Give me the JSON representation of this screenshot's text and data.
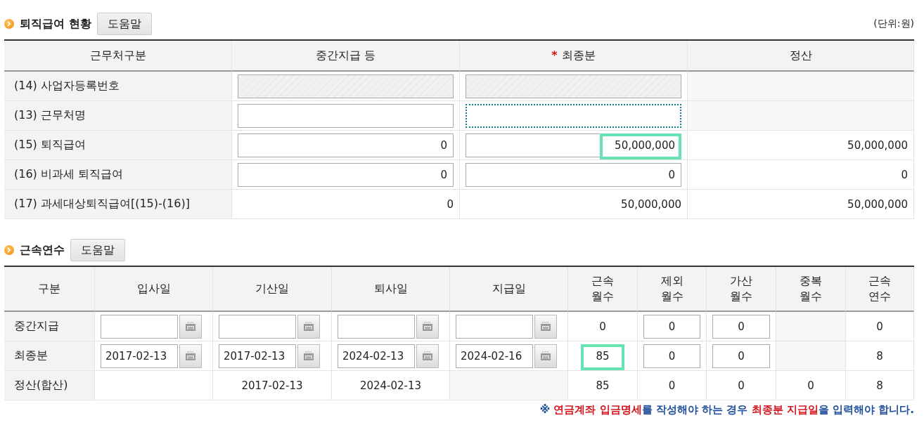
{
  "sections": [
    {
      "title": "퇴직급여 현황",
      "help_button": "도움말",
      "unit": "(단위:원)",
      "columns": [
        {
          "label": "근무처구분",
          "required": false
        },
        {
          "label": "중간지급 등",
          "required": false
        },
        {
          "label": "최종분",
          "required": true,
          "required_mark": "*"
        },
        {
          "label": "정산",
          "required": false
        }
      ],
      "rows": [
        {
          "cells": [
            {
              "kind": "label",
              "value": "(14) 사업자등록번호"
            },
            {
              "kind": "disabled"
            },
            {
              "kind": "disabled"
            },
            {
              "kind": "blank"
            }
          ]
        },
        {
          "cells": [
            {
              "kind": "label",
              "value": "(13) 근무처명"
            },
            {
              "kind": "input",
              "focused": false
            },
            {
              "kind": "input",
              "focused": true
            },
            {
              "kind": "blank"
            }
          ]
        },
        {
          "cells": [
            {
              "kind": "label",
              "value": "(15) 퇴직급여"
            },
            {
              "kind": "input",
              "value": "0",
              "focused": false
            },
            {
              "kind": "input",
              "value": "50,000,000",
              "focused": false,
              "highlighted": true
            },
            {
              "kind": "text",
              "value": "50,000,000"
            }
          ]
        },
        {
          "cells": [
            {
              "kind": "label",
              "value": "(16) 비과세 퇴직급여"
            },
            {
              "kind": "input",
              "value": "0",
              "focused": false
            },
            {
              "kind": "input",
              "value": "0",
              "focused": false
            },
            {
              "kind": "text",
              "value": "0"
            }
          ]
        },
        {
          "cells": [
            {
              "kind": "label",
              "value": "(17) 과세대상퇴직급여[(15)-(16)]"
            },
            {
              "kind": "text",
              "value": "0"
            },
            {
              "kind": "text",
              "value": "50,000,000"
            },
            {
              "kind": "text",
              "value": "50,000,000"
            }
          ]
        }
      ]
    },
    {
      "title": "근속연수",
      "help_button": "도움말",
      "columns": [
        {
          "label": "구분",
          "required": false
        },
        {
          "label": "입사일",
          "required": false
        },
        {
          "label": "기산일",
          "required": false
        },
        {
          "label": "퇴사일",
          "required": false
        },
        {
          "label": "지급일",
          "required": false
        },
        {
          "label": "근속\n월수",
          "required": false
        },
        {
          "label": "제외\n월수",
          "required": false
        },
        {
          "label": "가산\n월수",
          "required": false
        },
        {
          "label": "중복\n월수",
          "required": false
        },
        {
          "label": "근속\n연수",
          "required": false
        }
      ],
      "rows": [
        {
          "cells": [
            {
              "kind": "label",
              "value": "중간지급"
            },
            {
              "kind": "date"
            },
            {
              "kind": "date"
            },
            {
              "kind": "date"
            },
            {
              "kind": "date"
            },
            {
              "kind": "center",
              "value": "0"
            },
            {
              "kind": "input",
              "value": "0"
            },
            {
              "kind": "input",
              "value": "0"
            },
            {
              "kind": "blank"
            },
            {
              "kind": "center",
              "value": "0"
            }
          ]
        },
        {
          "cells": [
            {
              "kind": "label",
              "value": "최종분"
            },
            {
              "kind": "date",
              "value": "2017-02-13"
            },
            {
              "kind": "date",
              "value": "2017-02-13"
            },
            {
              "kind": "date",
              "value": "2024-02-13"
            },
            {
              "kind": "date",
              "value": "2024-02-16"
            },
            {
              "kind": "center",
              "value": "85",
              "highlighted": true
            },
            {
              "kind": "input",
              "value": "0"
            },
            {
              "kind": "input",
              "value": "0"
            },
            {
              "kind": "blank"
            },
            {
              "kind": "center",
              "value": "8"
            }
          ]
        },
        {
          "cells": [
            {
              "kind": "label",
              "value": "정산(합산)"
            },
            {
              "kind": "empty"
            },
            {
              "kind": "center",
              "value": "2017-02-13"
            },
            {
              "kind": "center",
              "value": "2024-02-13"
            },
            {
              "kind": "blank"
            },
            {
              "kind": "center",
              "value": "85"
            },
            {
              "kind": "center",
              "value": "0"
            },
            {
              "kind": "center",
              "value": "0"
            },
            {
              "kind": "center",
              "value": "0"
            },
            {
              "kind": "center",
              "value": "8"
            }
          ]
        }
      ],
      "note": [
        {
          "text": "※ ",
          "color": "#1f4e9c"
        },
        {
          "text": "연금계좌 입금명세",
          "color": "#d4141c"
        },
        {
          "text": "를 작성해야 하는 경우 ",
          "color": "#1f4e9c"
        },
        {
          "text": "최종분 지급일",
          "color": "#d4141c"
        },
        {
          "text": "을 입력해야 합니다.",
          "color": "#1f4e9c"
        }
      ]
    }
  ]
}
